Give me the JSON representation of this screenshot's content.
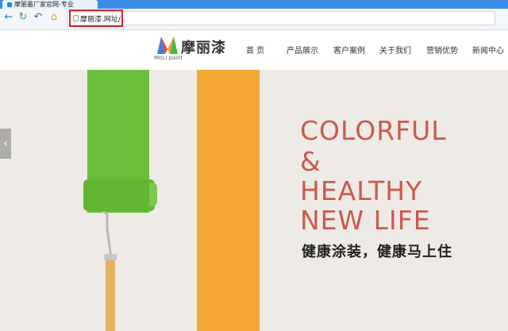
{
  "browser": {
    "tab_title": "摩丽墨厂家官网-专业",
    "address": "摩丽漆.网址/",
    "back_icon": "back-arrow-icon",
    "refresh_icon": "refresh-icon",
    "undo_icon": "undo-icon",
    "home_icon": "home-icon",
    "accent_color": "#3b8be6",
    "highlight_color": "#d6232b"
  },
  "site": {
    "logo_cn": "摩丽漆",
    "logo_en": "MoLi paint",
    "nav": [
      "首 页",
      "产品展示",
      "客户案例",
      "关于我们",
      "营销优势",
      "新闻中心"
    ]
  },
  "hero": {
    "headline": [
      "COLORFUL",
      "&",
      "HEALTHY",
      "NEW LIFE"
    ],
    "tagline": "健康涂装，健康马上住",
    "headline_color": "#cc5a4b",
    "stripe_green": "#6bbf3a",
    "stripe_orange": "#f4a834"
  }
}
